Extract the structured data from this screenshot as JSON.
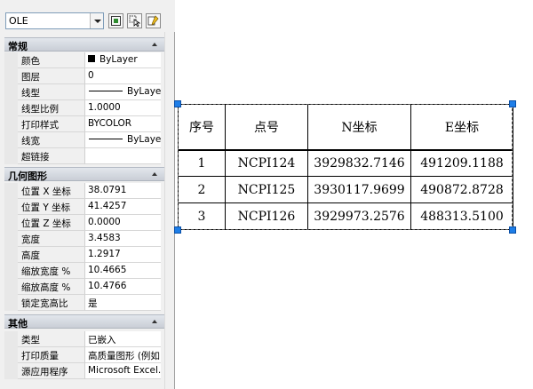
{
  "palette": {
    "object_type_select": "OLE",
    "toolbar": {
      "btn1_icon": "toggle-pickadd-icon",
      "btn2_icon": "select-objects-icon",
      "btn3_icon": "quick-select-icon"
    },
    "sections": [
      {
        "title": "常规",
        "rows": [
          {
            "name": "颜色",
            "value": "ByLayer",
            "kind": "color"
          },
          {
            "name": "图层",
            "value": "0",
            "kind": "text"
          },
          {
            "name": "线型",
            "value": "ByLayer",
            "kind": "line"
          },
          {
            "name": "线型比例",
            "value": "1.0000",
            "kind": "text"
          },
          {
            "name": "打印样式",
            "value": "BYCOLOR",
            "kind": "text"
          },
          {
            "name": "线宽",
            "value": "ByLayer",
            "kind": "line"
          },
          {
            "name": "超链接",
            "value": "",
            "kind": "text"
          }
        ]
      },
      {
        "title": "几何图形",
        "rows": [
          {
            "name": "位置 X 坐标",
            "value": "38.0791",
            "kind": "text"
          },
          {
            "name": "位置 Y 坐标",
            "value": "41.4257",
            "kind": "text"
          },
          {
            "name": "位置 Z 坐标",
            "value": "0.0000",
            "kind": "text"
          },
          {
            "name": "宽度",
            "value": "3.4583",
            "kind": "text"
          },
          {
            "name": "高度",
            "value": "1.2917",
            "kind": "text"
          },
          {
            "name": "缩放宽度 %",
            "value": "10.4665",
            "kind": "text"
          },
          {
            "name": "缩放高度 %",
            "value": "10.4766",
            "kind": "text"
          },
          {
            "name": "锁定宽高比",
            "value": "是",
            "kind": "text"
          }
        ]
      },
      {
        "title": "其他",
        "rows": [
          {
            "name": "类型",
            "value": "已嵌入",
            "kind": "text"
          },
          {
            "name": "打印质量",
            "value": "高质量图形 (例如...",
            "kind": "text"
          },
          {
            "name": "源应用程序",
            "value": "Microsoft Excel...",
            "kind": "text"
          }
        ]
      }
    ]
  },
  "table": {
    "headers": [
      "序号",
      "点号",
      "N坐标",
      "E坐标"
    ],
    "rows": [
      [
        "1",
        "NCPI124",
        "3929832.7146",
        "491209.1188"
      ],
      [
        "2",
        "NCPI125",
        "3930117.9699",
        "490872.8728"
      ],
      [
        "3",
        "NCPI126",
        "3929973.2576",
        "488313.5100"
      ]
    ]
  },
  "colors": {
    "grip": "#1e7ee8",
    "color_swatch": "#000000"
  }
}
